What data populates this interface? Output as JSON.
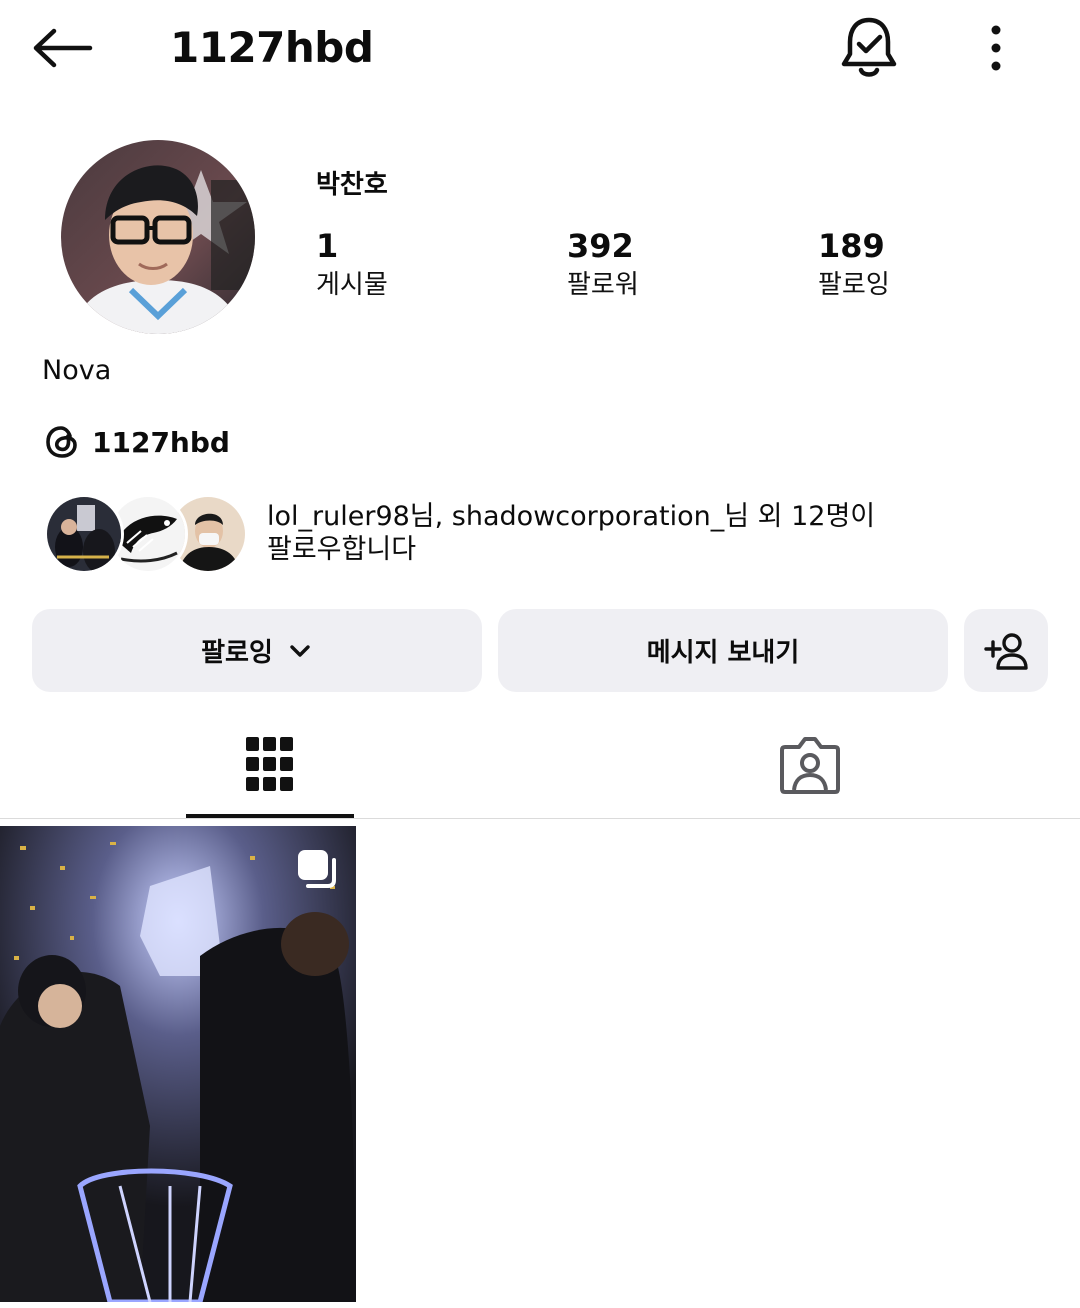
{
  "header": {
    "username": "1127hbd",
    "back_icon": "arrow-left-icon",
    "notification_icon": "bell-check-icon",
    "more_icon": "more-vertical-icon"
  },
  "profile": {
    "display_name": "박찬호",
    "stats": [
      {
        "value": "1",
        "label": "게시물"
      },
      {
        "value": "392",
        "label": "팔로워"
      },
      {
        "value": "189",
        "label": "팔로잉"
      }
    ],
    "bio_name": "Nova",
    "threads_handle": "1127hbd"
  },
  "mutual": {
    "text_line1": "lol_ruler98님, shadowcorporation_님 외 12명이",
    "text_line2": "팔로우합니다"
  },
  "actions": {
    "following_label": "팔로잉",
    "message_label": "메시지 보내기",
    "add_icon": "add-person-icon"
  },
  "tabs": [
    {
      "name": "posts",
      "icon": "grid-icon",
      "active": true
    },
    {
      "name": "tagged",
      "icon": "tagged-person-icon",
      "active": false
    }
  ],
  "posts": [
    {
      "type": "carousel",
      "icon": "multiple-images-icon"
    }
  ],
  "colors": {
    "button_bg": "#efeff3",
    "text": "#0c0c0c",
    "divider": "#dbdbdb"
  }
}
